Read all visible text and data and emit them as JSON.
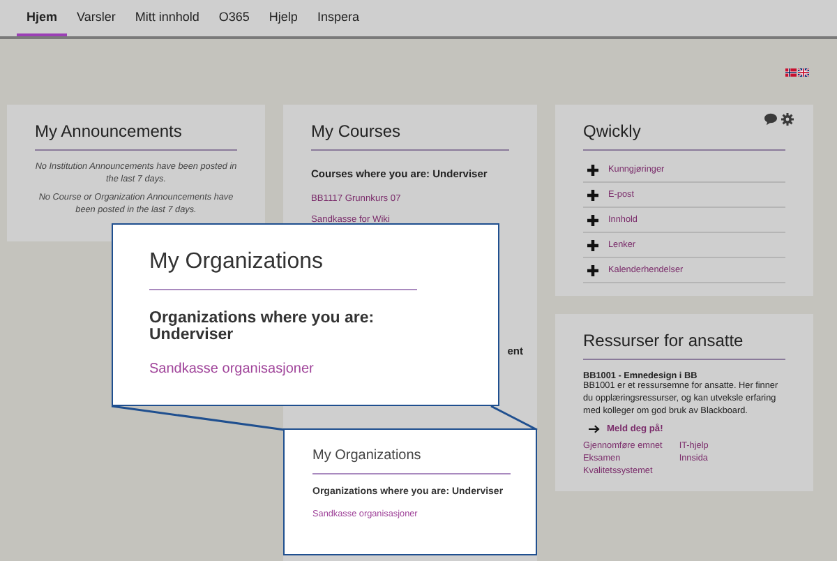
{
  "nav": {
    "tabs": [
      {
        "label": "Hjem",
        "selected": true
      },
      {
        "label": "Varsler",
        "selected": false
      },
      {
        "label": "Mitt innhold",
        "selected": false
      },
      {
        "label": "O365",
        "selected": false
      },
      {
        "label": "Hjelp",
        "selected": false
      },
      {
        "label": "Inspera",
        "selected": false
      }
    ]
  },
  "announcements": {
    "title": "My Announcements",
    "messages": [
      "No Institution Announcements have been posted in the last 7 days.",
      "No Course or Organization Announcements have been posted in the last 7 days."
    ]
  },
  "courses": {
    "title": "My Courses",
    "heading": "Courses where you are: Underviser",
    "links": [
      "BB1117 Grunnkurs 07",
      "Sandkasse for Wiki"
    ],
    "partial_heading": "ent"
  },
  "qwickly": {
    "title": "Qwickly",
    "items": [
      "Kunngjøringer",
      "E-post",
      "Innhold",
      "Lenker",
      "Kalenderhendelser"
    ]
  },
  "resources": {
    "title": "Ressurser for ansatte",
    "course_title": "BB1001 - Emnedesign i BB",
    "description": "BB1001 er et ressursemne for ansatte. Her finner du opplæringsressurser, og kan utveksle erfaring med kolleger om god bruk av Blackboard.",
    "signup": "Meld deg på!",
    "links": [
      [
        "Gjennomføre emnet",
        "Eksamen",
        "Kvalitetssystemet"
      ],
      [
        "IT-hjelp",
        "Innsida"
      ]
    ]
  },
  "callout_large": {
    "title": "My Organizations",
    "heading": "Organizations where you are: Underviser",
    "link": "Sandkasse organisasjoner"
  },
  "callout_small": {
    "title": "My Organizations",
    "heading": "Organizations where you are: Underviser",
    "link": "Sandkasse organisasjoner"
  }
}
